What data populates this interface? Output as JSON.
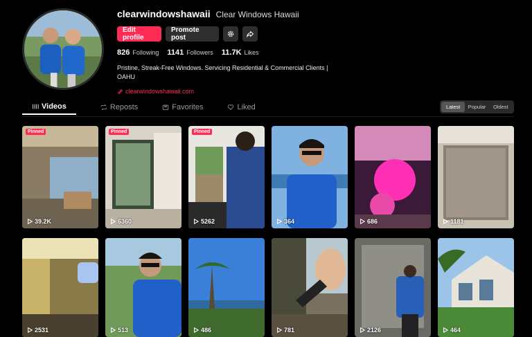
{
  "profile": {
    "username": "clearwindowshawaii",
    "display_name": "Clear Windows Hawaii",
    "edit_label": "Edit profile",
    "promote_label": "Promote post",
    "bio": "Pristine, Streak-Free Windows. Servicing Residential & Commercial Clients | OAHU",
    "website": "clearwindowshawaii.com"
  },
  "stats": {
    "following_count": "826",
    "following_label": "Following",
    "followers_count": "1141",
    "followers_label": "Followers",
    "likes_count": "11.7K",
    "likes_label": "Likes"
  },
  "tabs": [
    {
      "label": "Videos",
      "icon": "grid-icon"
    },
    {
      "label": "Reposts",
      "icon": "repost-icon"
    },
    {
      "label": "Favorites",
      "icon": "bookmark-icon"
    },
    {
      "label": "Liked",
      "icon": "heart-outline-icon"
    }
  ],
  "sort": {
    "latest": "Latest",
    "popular": "Popular",
    "oldest": "Oldest",
    "selected": "Latest"
  },
  "pinned_label": "Pinned",
  "videos": [
    {
      "views": "39.2K",
      "pinned": true
    },
    {
      "views": "6360",
      "pinned": true
    },
    {
      "views": "5262",
      "pinned": true
    },
    {
      "views": "364",
      "pinned": false
    },
    {
      "views": "686",
      "pinned": false
    },
    {
      "views": "1181",
      "pinned": false
    },
    {
      "views": "2531",
      "pinned": false
    },
    {
      "views": "513",
      "pinned": false
    },
    {
      "views": "486",
      "pinned": false
    },
    {
      "views": "781",
      "pinned": false
    },
    {
      "views": "2126",
      "pinned": false
    },
    {
      "views": "464",
      "pinned": false
    }
  ],
  "colors": {
    "accent": "#fe2c55",
    "background": "#000000",
    "button_gray": "#2f2f2f"
  }
}
